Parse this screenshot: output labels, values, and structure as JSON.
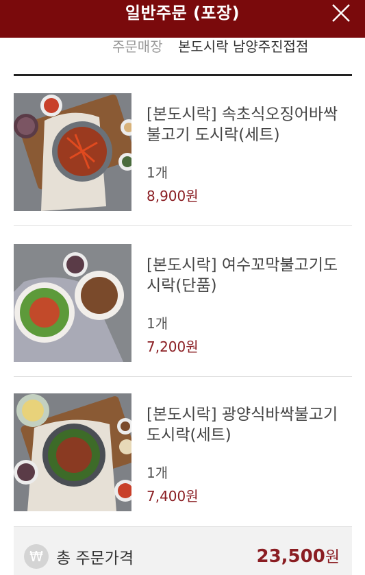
{
  "header": {
    "title": "일반주문 (포장)"
  },
  "store": {
    "label": "주문매장",
    "name": "본도시락 남양주진접점"
  },
  "items": [
    {
      "name": "[본도시락] 속초식오징어바싹불고기 도시락(세트)",
      "qty": "1개",
      "price": "8,900원"
    },
    {
      "name": "[본도시락] 여수꼬막불고기도시락(단품)",
      "qty": "1개",
      "price": "7,200원"
    },
    {
      "name": "[본도시락] 광양식바싹불고기도시락(세트)",
      "qty": "1개",
      "price": "7,400원"
    }
  ],
  "total": {
    "icon": "₩",
    "label": "총 주문가격",
    "value": "23,500",
    "unit": "원"
  },
  "colors": {
    "header_bg": "#7a0a0c",
    "accent": "#8a1d22"
  },
  "icons": {
    "close": "close-icon",
    "currency": "won-icon"
  }
}
